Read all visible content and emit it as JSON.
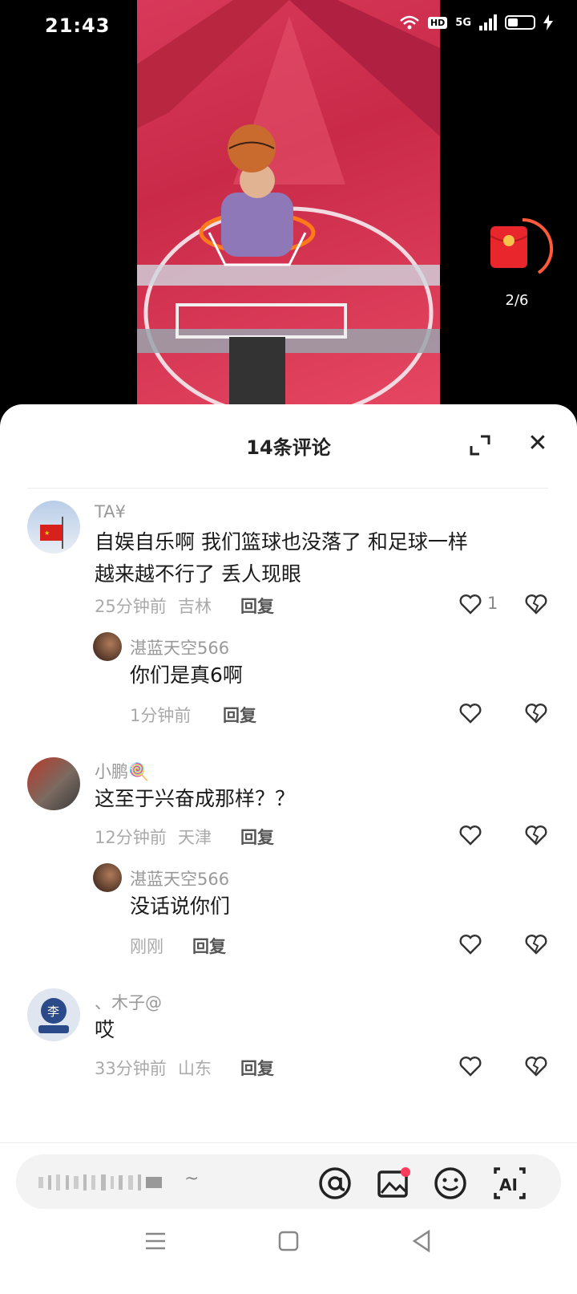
{
  "status_bar": {
    "time": "21:43",
    "hd": "HD",
    "network": "5G"
  },
  "video": {
    "redpacket_progress": "2/6"
  },
  "comments_sheet": {
    "title": "14条评论"
  },
  "comments": [
    {
      "username": "TA¥",
      "text_line1": "自娱自乐啊  我们篮球也没落了  和足球一样",
      "text_line2": "越来越不行了 丢人现眼",
      "time": "25分钟前",
      "location": "吉林",
      "reply_label": "回复",
      "like_count": "1"
    },
    {
      "username": "湛蓝天空566",
      "text": "你们是真6啊",
      "time": "1分钟前",
      "reply_label": "回复"
    },
    {
      "username": "小鹏🍭",
      "text": "这至于兴奋成那样？？",
      "time": "12分钟前",
      "location": "天津",
      "reply_label": "回复"
    },
    {
      "username": "湛蓝天空566",
      "text": "没话说你们",
      "time": "刚刚",
      "reply_label": "回复"
    },
    {
      "username": "、木子@",
      "text": "哎",
      "time": "33分钟前",
      "location": "山东",
      "reply_label": "回复",
      "avatar_char": "李"
    }
  ],
  "input_bar": {
    "placeholder": "~"
  },
  "icons": [
    "at-icon",
    "image-icon",
    "emoji-icon",
    "ai-icon",
    "heart-icon",
    "broken-heart-icon",
    "expand-icon",
    "close-icon",
    "redpacket-icon",
    "menu-icon",
    "home-icon",
    "back-icon"
  ]
}
